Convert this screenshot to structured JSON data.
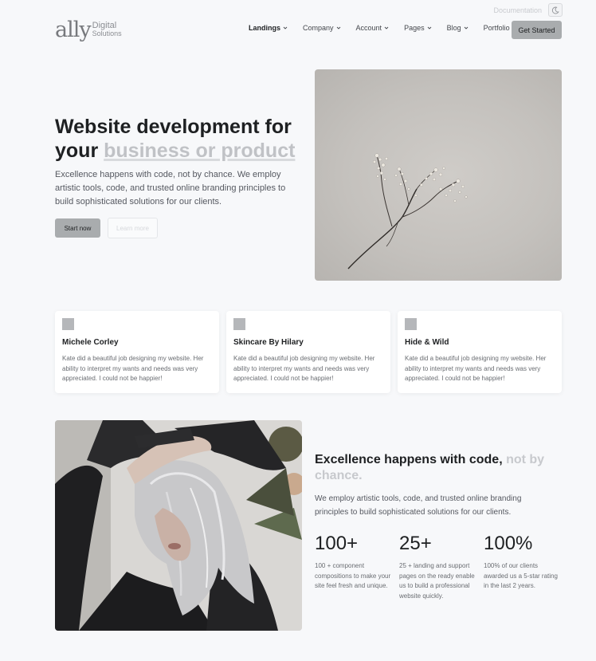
{
  "topbar": {
    "documentation": "Documentation"
  },
  "logo": {
    "mark": "ally",
    "line1": "Digital",
    "line2": "Solutions"
  },
  "nav": {
    "items": [
      {
        "label": "Landings"
      },
      {
        "label": "Company"
      },
      {
        "label": "Account"
      },
      {
        "label": "Pages"
      },
      {
        "label": "Blog"
      },
      {
        "label": "Portfolio"
      }
    ],
    "cta": "Get Started"
  },
  "hero": {
    "title_part1": "Website development for your ",
    "title_highlight": "business or product",
    "description": "Excellence happens with code, not by chance. We employ artistic tools, code, and trusted online branding principles to build sophisticated solutions for our clients.",
    "primary_button": "Start now",
    "secondary_button": "Learn more"
  },
  "testimonials": [
    {
      "name": "Michele Corley",
      "text": "Kate did a beautiful job designing my website. Her ability to interpret my wants and needs was very appreciated. I could not be happier!"
    },
    {
      "name": "Skincare By Hilary",
      "text": "Kate did a beautiful job designing my website. Her ability to interpret my wants and needs was very appreciated. I could not be happier!"
    },
    {
      "name": "Hide & Wild",
      "text": "Kate did a beautiful job designing my website. Her ability to interpret my wants and needs was very appreciated. I could not be happier!"
    }
  ],
  "feature": {
    "title_part1": "Excellence happens with code, ",
    "title_muted": "not by chance.",
    "description": "We employ artistic tools, code, and trusted online branding principles to build sophisticated solutions for our clients.",
    "stats": [
      {
        "value": "100+",
        "text": "100 + component compositions to make your site feel fresh and unique."
      },
      {
        "value": "25+",
        "text": "25 + landing and support pages on the ready enable us to build a professional website quickly."
      },
      {
        "value": "100%",
        "text": "100% of our clients awarded us a 5-star rating in the last 2 years."
      }
    ]
  },
  "colors": {
    "accent": "#a9acae",
    "text": "#1e2022",
    "muted": "#c0c2c6",
    "background": "#f7f8fa"
  },
  "icons": {
    "mode_toggle": "moon-icon",
    "nav_dropdown": "chevron-down-icon",
    "testimonial_avatar": "avatar-placeholder"
  }
}
